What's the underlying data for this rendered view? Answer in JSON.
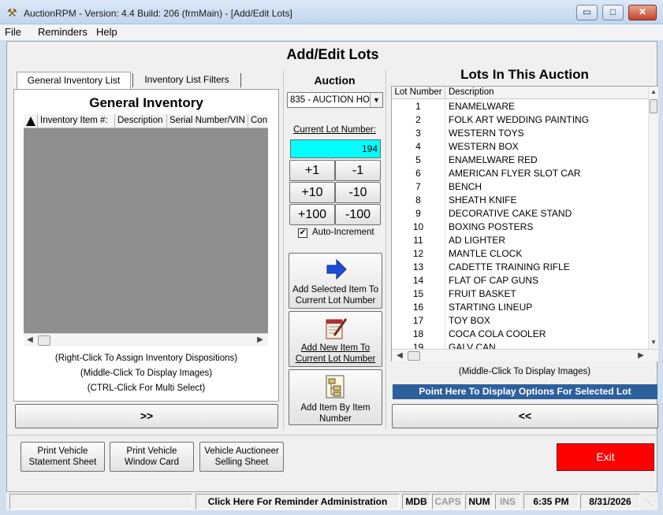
{
  "window": {
    "title": "AuctionRPM - Version: 4.4 Build: 206    (frmMain) - [Add/Edit Lots]",
    "icon": "gavel-icon",
    "minimize": "▭",
    "maximize": "□",
    "close": "✕"
  },
  "menu": [
    "File",
    "Reminders",
    "Help"
  ],
  "page_title": "Add/Edit Lots",
  "left": {
    "tabs": [
      "General Inventory List",
      "Inventory List Filters"
    ],
    "heading": "General Inventory",
    "columns": [
      "Inventory Item #:",
      "Description",
      "Serial Number/VIN",
      "Con"
    ],
    "hints": [
      "(Right-Click To Assign Inventory Dispositions)",
      "(Middle-Click To Display Images)",
      "(CTRL-Click For Multi Select)"
    ],
    "move_button": ">>"
  },
  "auction": {
    "label": "Auction",
    "selected": "835 - AUCTION HO",
    "current_lot_label": "Current Lot Number:",
    "current_lot_value": "194",
    "increments": [
      "+1",
      "-1",
      "+10",
      "-10",
      "+100",
      "-100"
    ],
    "auto_increment_label": "Auto-Increment",
    "auto_increment_checked": true,
    "add_selected_label": "Add Selected Item To Current Lot Number",
    "add_new_label": "Add New Item To Current Lot Number",
    "add_by_number_label": "Add Item By Item Number"
  },
  "lots": {
    "heading": "Lots In This Auction",
    "columns": [
      "Lot Number",
      "Description"
    ],
    "rows": [
      {
        "num": "1",
        "desc": "ENAMELWARE"
      },
      {
        "num": "2",
        "desc": "FOLK ART WEDDING PAINTING"
      },
      {
        "num": "3",
        "desc": "WESTERN TOYS"
      },
      {
        "num": "4",
        "desc": "WESTERN BOX"
      },
      {
        "num": "5",
        "desc": "ENAMELWARE RED"
      },
      {
        "num": "6",
        "desc": "AMERICAN FLYER SLOT CAR"
      },
      {
        "num": "7",
        "desc": "BENCH"
      },
      {
        "num": "8",
        "desc": "SHEATH KNIFE"
      },
      {
        "num": "9",
        "desc": "DECORATIVE CAKE STAND"
      },
      {
        "num": "10",
        "desc": "BOXING POSTERS"
      },
      {
        "num": "11",
        "desc": "AD LIGHTER"
      },
      {
        "num": "12",
        "desc": "MANTLE CLOCK"
      },
      {
        "num": "13",
        "desc": "CADETTE TRAINING RIFLE"
      },
      {
        "num": "14",
        "desc": "FLAT OF CAP GUNS"
      },
      {
        "num": "15",
        "desc": "FRUIT BASKET"
      },
      {
        "num": "16",
        "desc": "STARTING LINEUP"
      },
      {
        "num": "17",
        "desc": "TOY BOX"
      },
      {
        "num": "18",
        "desc": "COCA COLA COOLER"
      },
      {
        "num": "19",
        "desc": "GALV CAN"
      }
    ],
    "hint": "(Middle-Click To Display Images)",
    "options_bar": "Point Here To Display Options For Selected Lot",
    "move_button": "<<"
  },
  "bottom": {
    "buttons": [
      "Print Vehicle Statement Sheet",
      "Print Vehicle Window Card",
      "Vehicle Auctioneer Selling Sheet"
    ],
    "exit": "Exit"
  },
  "status": {
    "reminder": "Click Here For Reminder Administration",
    "mdb": "MDB",
    "caps": "CAPS",
    "num": "NUM",
    "ins": "INS",
    "time": "6:35 PM",
    "date": "8/31/2026"
  },
  "colors": {
    "lot_field": "#00ffff",
    "options_bar": "#2d5f9c",
    "exit": "#ff0000"
  }
}
